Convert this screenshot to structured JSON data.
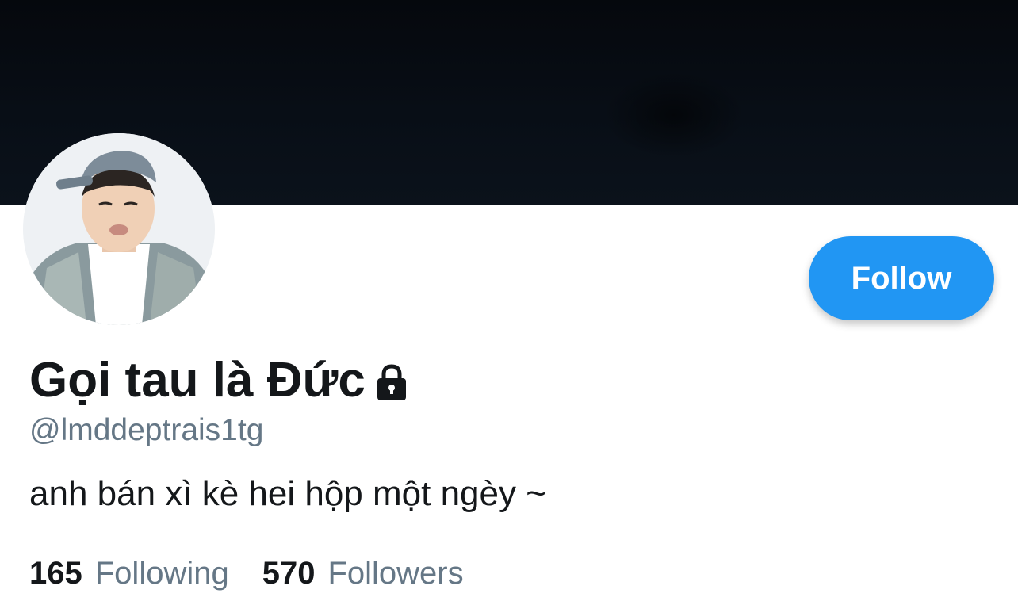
{
  "profile": {
    "display_name": "Gọi tau là Đức",
    "handle": "@lmddeptrais1tg",
    "bio": "anh bán xì kè hei hộp một ngèy ~",
    "protected_icon": "lock-icon",
    "avatar_icon": "profile-avatar"
  },
  "actions": {
    "follow_label": "Follow"
  },
  "stats": {
    "following_count": "165",
    "following_label": "Following",
    "followers_count": "570",
    "followers_label": "Followers"
  },
  "colors": {
    "banner": "#080e16",
    "accent": "#2196f3",
    "primary_text": "#14171a",
    "secondary_text": "#657786"
  }
}
